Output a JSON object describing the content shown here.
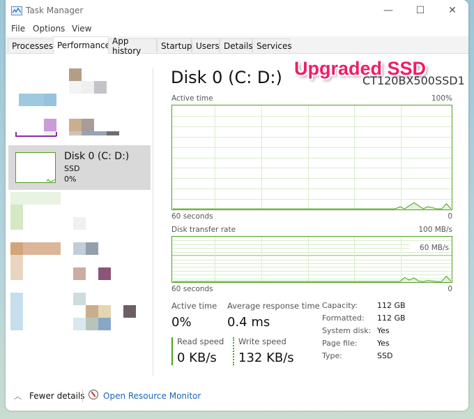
{
  "window": {
    "title": "Task Manager",
    "controls": {
      "minimize": "—",
      "maximize": "☐",
      "close": "✕"
    }
  },
  "menu": [
    "File",
    "Options",
    "View"
  ],
  "tabs": [
    {
      "label": "Processes",
      "active": false
    },
    {
      "label": "Performance",
      "active": true
    },
    {
      "label": "App history",
      "active": false
    },
    {
      "label": "Startup",
      "active": false
    },
    {
      "label": "Users",
      "active": false
    },
    {
      "label": "Details",
      "active": false
    },
    {
      "label": "Services",
      "active": false
    }
  ],
  "sidebar": {
    "selected": {
      "name": "Disk 0 (C: D:)",
      "type": "SSD",
      "percent": "0%"
    }
  },
  "main": {
    "title": "Disk 0 (C: D:)",
    "model": "CT120BX500SSD1",
    "overlay_badge": "Upgraded SSD",
    "active_time_chart": {
      "label": "Active time",
      "max_label": "100%",
      "x_left": "60 seconds",
      "x_right": "0"
    },
    "transfer_chart": {
      "label": "Disk transfer rate",
      "max_label": "100 MB/s",
      "mid_label": "60 MB/s",
      "x_left": "60 seconds",
      "x_right": "0"
    },
    "stats": {
      "active_time": {
        "label": "Active time",
        "value": "0%"
      },
      "avg_response": {
        "label": "Average response time",
        "value": "0.4 ms"
      },
      "read_speed": {
        "label": "Read speed",
        "value": "0 KB/s"
      },
      "write_speed": {
        "label": "Write speed",
        "value": "132 KB/s"
      }
    },
    "properties": [
      {
        "label": "Capacity:",
        "value": "112 GB"
      },
      {
        "label": "Formatted:",
        "value": "112 GB"
      },
      {
        "label": "System disk:",
        "value": "Yes"
      },
      {
        "label": "Page file:",
        "value": "Yes"
      },
      {
        "label": "Type:",
        "value": "SSD"
      }
    ]
  },
  "chart_data": [
    {
      "type": "area",
      "title": "Active time",
      "xlabel": "60 seconds",
      "ylabel": "",
      "xlim": [
        60,
        0
      ],
      "ylim": [
        0,
        100
      ],
      "grid": true,
      "x": [
        60,
        55,
        50,
        45,
        40,
        35,
        30,
        25,
        20,
        15,
        12,
        11,
        10,
        9,
        8,
        7,
        6,
        5,
        4,
        3,
        2,
        1,
        0
      ],
      "series": [
        {
          "name": "Active time (%)",
          "values": [
            0,
            0,
            0,
            0,
            0,
            0,
            0,
            0,
            0,
            0,
            0,
            2,
            0,
            3,
            6,
            3,
            0,
            2,
            1,
            0,
            0,
            5,
            0
          ]
        }
      ]
    },
    {
      "type": "area",
      "title": "Disk transfer rate",
      "xlabel": "60 seconds",
      "ylabel": "",
      "xlim": [
        60,
        0
      ],
      "ylim": [
        0,
        100
      ],
      "grid": true,
      "x": [
        60,
        55,
        50,
        45,
        40,
        35,
        30,
        25,
        20,
        15,
        12,
        11,
        10,
        9,
        8,
        7,
        6,
        5,
        4,
        3,
        2,
        1,
        0
      ],
      "series": [
        {
          "name": "Read (MB/s)",
          "values": [
            0,
            0,
            0,
            0,
            0,
            0,
            0,
            0,
            0,
            0,
            0,
            0,
            0,
            0,
            0,
            0,
            0,
            0,
            0,
            0,
            0,
            0,
            0
          ]
        },
        {
          "name": "Write (MB/s)",
          "values": [
            0,
            0,
            0,
            0,
            0,
            0,
            0,
            0,
            0,
            0,
            0,
            0,
            9,
            3,
            8,
            1,
            0,
            2,
            1,
            0,
            0,
            12,
            0
          ]
        }
      ]
    }
  ],
  "footer": {
    "fewer_details": "Fewer details",
    "resource_monitor": "Open Resource Monitor"
  }
}
